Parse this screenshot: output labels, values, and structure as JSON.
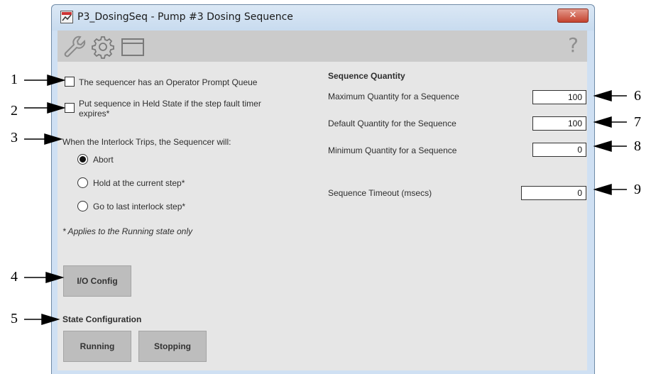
{
  "window": {
    "title": "P3_DosingSeq - Pump #3 Dosing Sequence",
    "close_label": "✕"
  },
  "toolbar": {
    "icons": [
      "wrench-icon",
      "gear-icon",
      "window-icon"
    ],
    "help_label": "?"
  },
  "options": {
    "operator_prompt_queue": {
      "label": "The sequencer has an Operator Prompt Queue",
      "checked": false
    },
    "held_state": {
      "label_line1": "Put sequence in Held State if the step fault timer",
      "label_line2": "expires*",
      "checked": false
    }
  },
  "interlock": {
    "label": "When the Interlock Trips, the Sequencer will:",
    "options": [
      {
        "label": "Abort",
        "selected": true
      },
      {
        "label": "Hold at the current step*",
        "selected": false
      },
      {
        "label": "Go to last interlock step*",
        "selected": false
      }
    ],
    "note": "* Applies to the Running state only"
  },
  "io_config_label": "I/O Config",
  "state_configuration": {
    "header": "State Configuration",
    "running_label": "Running",
    "stopping_label": "Stopping"
  },
  "sequence_quantity": {
    "header": "Sequence Quantity",
    "max_label": "Maximum Quantity for a Sequence",
    "max_value": "100",
    "default_label": "Default Quantity for the Sequence",
    "default_value": "100",
    "min_label": "Minimum Quantity for a Sequence",
    "min_value": "0",
    "timeout_label": "Sequence Timeout (msecs)",
    "timeout_value": "0"
  },
  "callouts": [
    "1",
    "2",
    "3",
    "4",
    "5",
    "6",
    "7",
    "8",
    "9"
  ],
  "colors": {
    "panel": "#e6e6e6",
    "toolbar": "#cbcbcb",
    "frame": "#cfe0f3",
    "close": "#c4432f"
  }
}
